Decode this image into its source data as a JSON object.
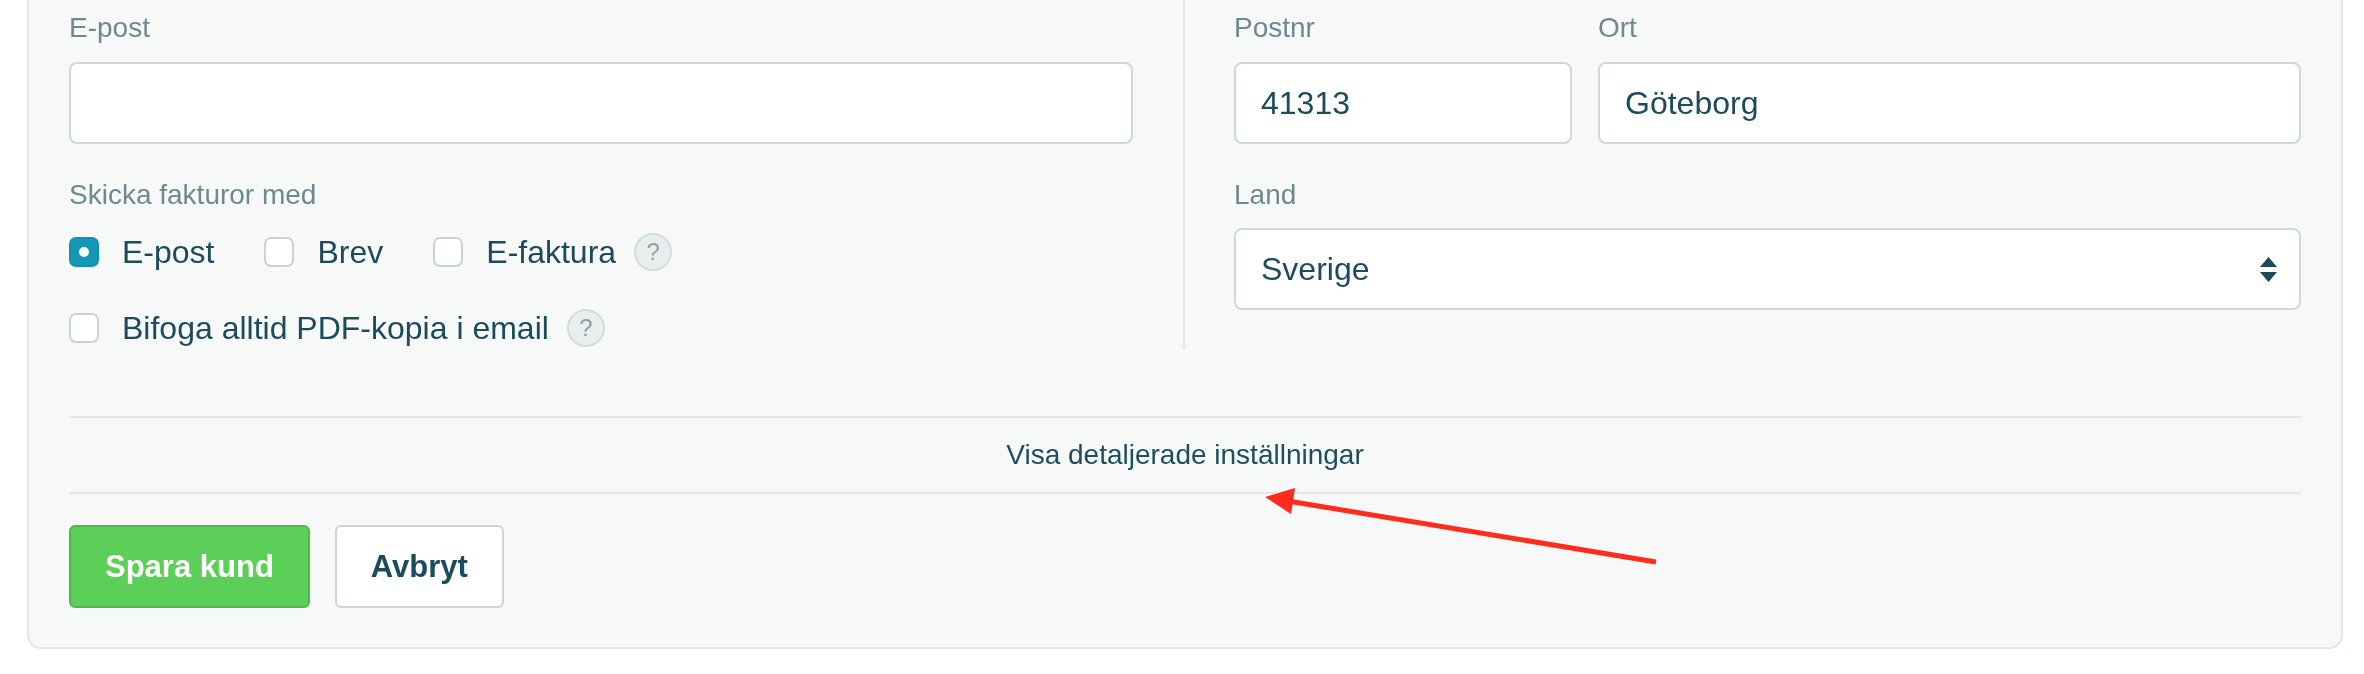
{
  "email": {
    "label": "E-post",
    "kind": "text"
  },
  "invoice_delivery": {
    "label": "Skicka fakturor med",
    "options": [
      {
        "label": "E-post",
        "checked": true
      },
      {
        "label": "Brev",
        "checked": false
      },
      {
        "label": "E-faktura",
        "checked": false,
        "help": "?"
      }
    ]
  },
  "attach_pdf": {
    "label": "Bifoga alltid PDF-kopia i email",
    "checked": false,
    "help": "?"
  },
  "postal_code": {
    "label": "Postnr",
    "kind": "text",
    "value": "41313"
  },
  "city": {
    "label": "Ort",
    "kind": "text",
    "value": "Göteborg"
  },
  "country": {
    "label": "Land",
    "kind": "select",
    "value": "Sverige"
  },
  "details_toggle": "Visa detaljerade inställningar",
  "buttons": [
    {
      "label": "Spara kund",
      "kind": "primary"
    },
    {
      "label": "Avbryt",
      "kind": "secondary"
    }
  ]
}
